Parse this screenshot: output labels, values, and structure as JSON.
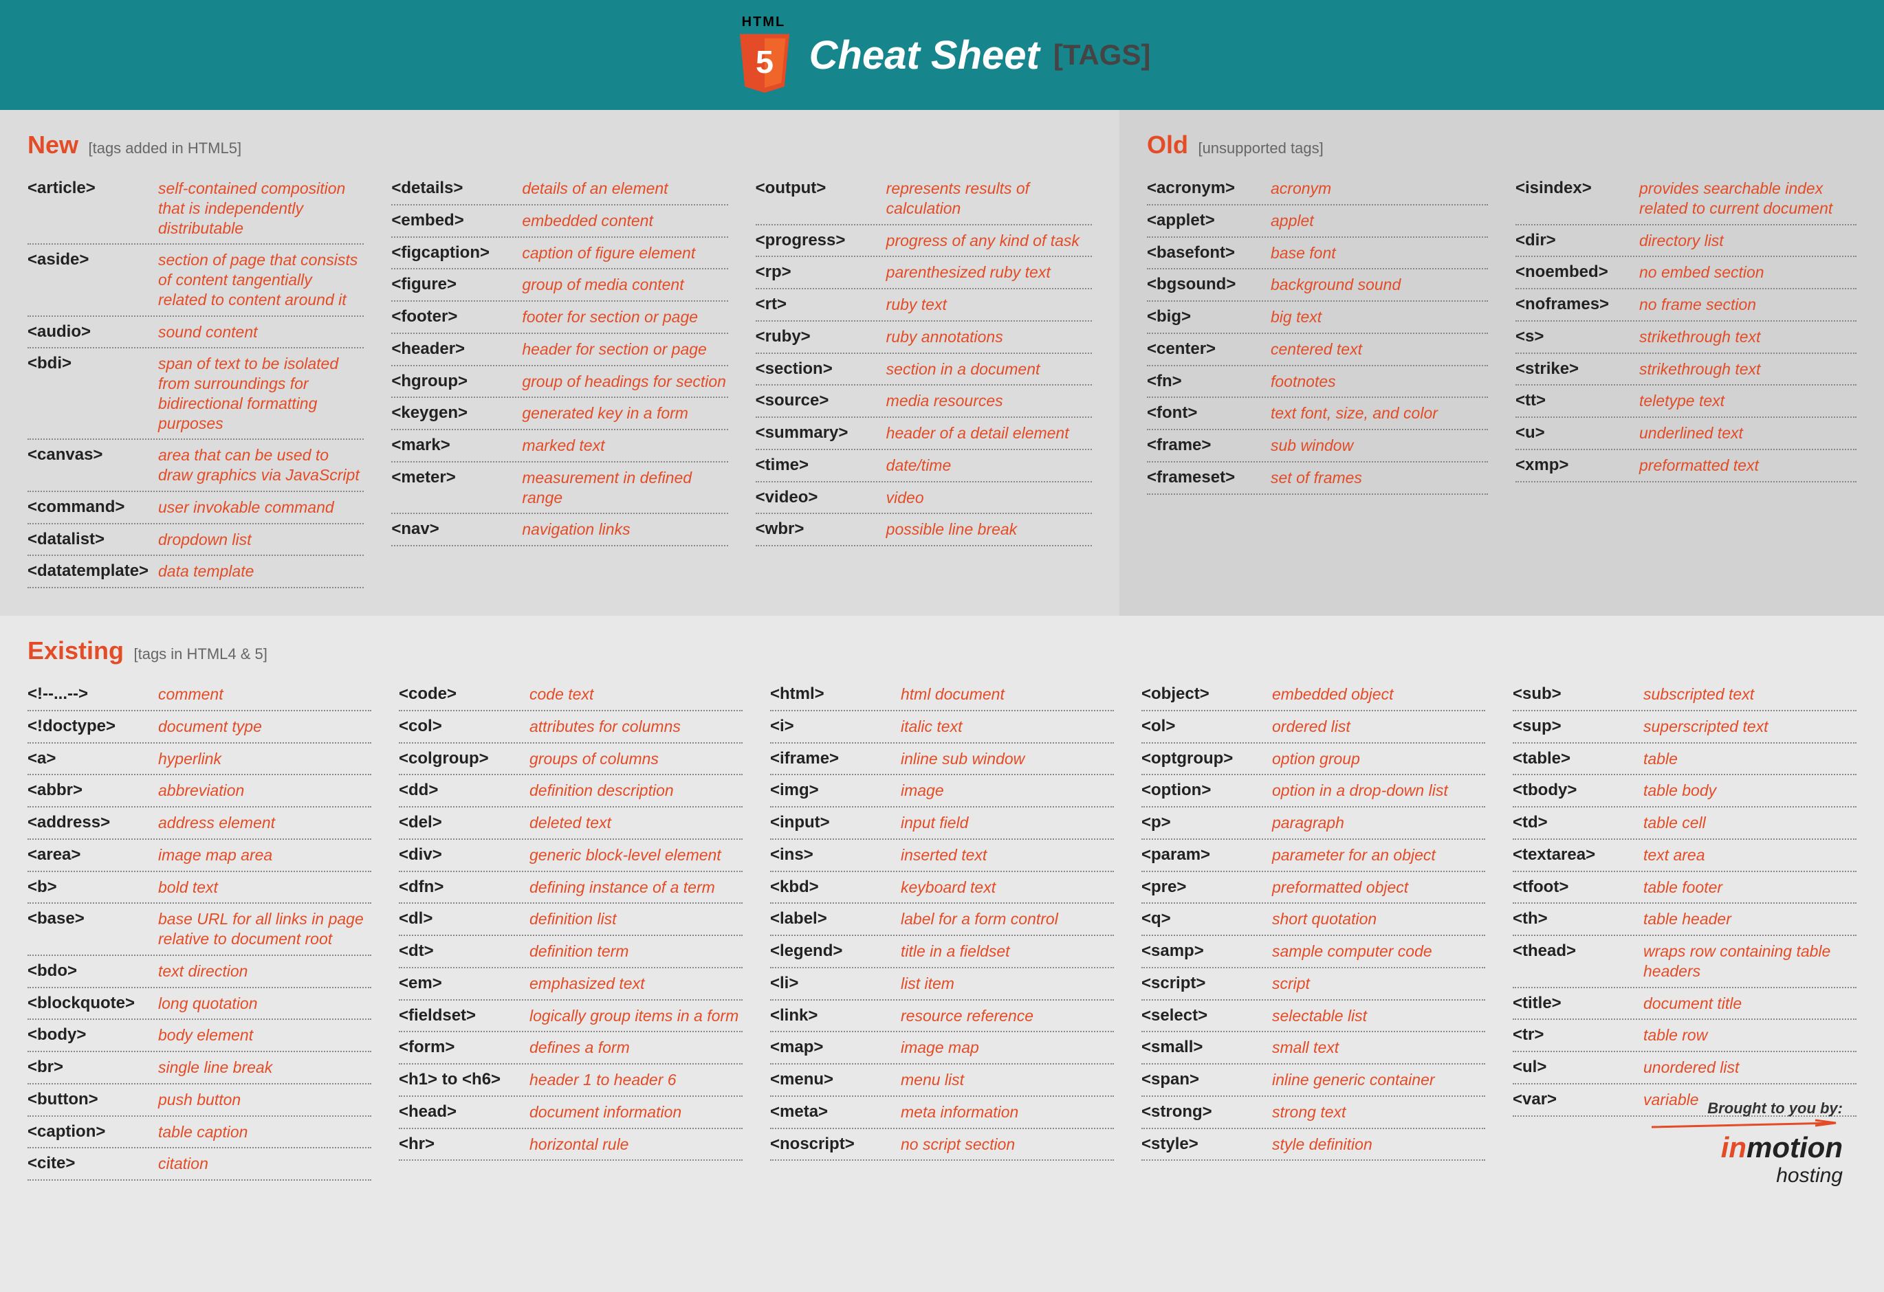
{
  "header": {
    "badge_label": "HTML",
    "title": "Cheat Sheet",
    "tags_label": "[TAGS]"
  },
  "new": {
    "title": "New",
    "subtitle": "[tags added in HTML5]",
    "cols": [
      [
        {
          "tag": "<article>",
          "desc": "self-contained composition that is independently distributable"
        },
        {
          "tag": "<aside>",
          "desc": "section of page that consists of content tangentially related to content around it"
        },
        {
          "tag": "<audio>",
          "desc": "sound content"
        },
        {
          "tag": "<bdi>",
          "desc": "span of text to be isolated from surroundings for bidirectional formatting purposes"
        },
        {
          "tag": "<canvas>",
          "desc": "area that can be used to draw graphics via JavaScript"
        },
        {
          "tag": "<command>",
          "desc": "user invokable command"
        },
        {
          "tag": "<datalist>",
          "desc": "dropdown list"
        },
        {
          "tag": "<datatemplate>",
          "desc": "data template"
        }
      ],
      [
        {
          "tag": "<details>",
          "desc": "details of an element"
        },
        {
          "tag": "<embed>",
          "desc": "embedded content"
        },
        {
          "tag": "<figcaption>",
          "desc": "caption of figure element"
        },
        {
          "tag": "<figure>",
          "desc": "group of media content"
        },
        {
          "tag": "<footer>",
          "desc": "footer for section or page"
        },
        {
          "tag": "<header>",
          "desc": "header for section or page"
        },
        {
          "tag": "<hgroup>",
          "desc": "group of headings for section"
        },
        {
          "tag": "<keygen>",
          "desc": "generated key in a form"
        },
        {
          "tag": "<mark>",
          "desc": "marked text"
        },
        {
          "tag": "<meter>",
          "desc": "measurement in defined range"
        },
        {
          "tag": "<nav>",
          "desc": "navigation links"
        }
      ],
      [
        {
          "tag": "<output>",
          "desc": "represents results of calculation"
        },
        {
          "tag": "<progress>",
          "desc": "progress of any kind of task"
        },
        {
          "tag": "<rp>",
          "desc": "parenthesized ruby text"
        },
        {
          "tag": "<rt>",
          "desc": "ruby text"
        },
        {
          "tag": "<ruby>",
          "desc": "ruby annotations"
        },
        {
          "tag": "<section>",
          "desc": "section in a document"
        },
        {
          "tag": "<source>",
          "desc": "media resources"
        },
        {
          "tag": "<summary>",
          "desc": "header of a detail element"
        },
        {
          "tag": "<time>",
          "desc": "date/time"
        },
        {
          "tag": "<video>",
          "desc": "video"
        },
        {
          "tag": "<wbr>",
          "desc": "possible line break"
        }
      ]
    ]
  },
  "old": {
    "title": "Old",
    "subtitle": "[unsupported tags]",
    "cols": [
      [
        {
          "tag": "<acronym>",
          "desc": "acronym"
        },
        {
          "tag": "<applet>",
          "desc": "applet"
        },
        {
          "tag": "<basefont>",
          "desc": "base font"
        },
        {
          "tag": "<bgsound>",
          "desc": "background sound"
        },
        {
          "tag": "<big>",
          "desc": "big text"
        },
        {
          "tag": "<center>",
          "desc": "centered text"
        },
        {
          "tag": "<fn>",
          "desc": "footnotes"
        },
        {
          "tag": "<font>",
          "desc": "text font, size, and color"
        },
        {
          "tag": "<frame>",
          "desc": "sub window"
        },
        {
          "tag": "<frameset>",
          "desc": "set of frames"
        }
      ],
      [
        {
          "tag": "<isindex>",
          "desc": "provides searchable index related to current document"
        },
        {
          "tag": "<dir>",
          "desc": "directory list"
        },
        {
          "tag": "<noembed>",
          "desc": "no embed section"
        },
        {
          "tag": "<noframes>",
          "desc": "no frame section"
        },
        {
          "tag": "<s>",
          "desc": "strikethrough text"
        },
        {
          "tag": "<strike>",
          "desc": "strikethrough text"
        },
        {
          "tag": "<tt>",
          "desc": "teletype text"
        },
        {
          "tag": "<u>",
          "desc": "underlined text"
        },
        {
          "tag": "<xmp>",
          "desc": "preformatted text"
        }
      ]
    ]
  },
  "existing": {
    "title": "Existing",
    "subtitle": "[tags in HTML4 & 5]",
    "cols": [
      [
        {
          "tag": "<!--...-->",
          "desc": "comment"
        },
        {
          "tag": "<!doctype>",
          "desc": "document type"
        },
        {
          "tag": "<a>",
          "desc": "hyperlink"
        },
        {
          "tag": "<abbr>",
          "desc": "abbreviation"
        },
        {
          "tag": "<address>",
          "desc": "address element"
        },
        {
          "tag": "<area>",
          "desc": "image map area"
        },
        {
          "tag": "<b>",
          "desc": "bold text"
        },
        {
          "tag": "<base>",
          "desc": "base URL for all links in page relative to document root"
        },
        {
          "tag": "<bdo>",
          "desc": "text direction"
        },
        {
          "tag": "<blockquote>",
          "desc": "long quotation"
        },
        {
          "tag": "<body>",
          "desc": "body element"
        },
        {
          "tag": "<br>",
          "desc": "single line break"
        },
        {
          "tag": "<button>",
          "desc": "push button"
        },
        {
          "tag": "<caption>",
          "desc": "table caption"
        },
        {
          "tag": "<cite>",
          "desc": "citation"
        }
      ],
      [
        {
          "tag": "<code>",
          "desc": "code text"
        },
        {
          "tag": "<col>",
          "desc": "attributes for columns"
        },
        {
          "tag": "<colgroup>",
          "desc": "groups of columns"
        },
        {
          "tag": "<dd>",
          "desc": "definition description"
        },
        {
          "tag": "<del>",
          "desc": "deleted text"
        },
        {
          "tag": "<div>",
          "desc": "generic block-level element"
        },
        {
          "tag": "<dfn>",
          "desc": "defining instance of a term"
        },
        {
          "tag": "<dl>",
          "desc": "definition list"
        },
        {
          "tag": "<dt>",
          "desc": "definition term"
        },
        {
          "tag": "<em>",
          "desc": "emphasized text"
        },
        {
          "tag": "<fieldset>",
          "desc": "logically group items in a form"
        },
        {
          "tag": "<form>",
          "desc": "defines a form"
        },
        {
          "tag": "<h1> to <h6>",
          "desc": "header 1 to header 6"
        },
        {
          "tag": "<head>",
          "desc": "document information"
        },
        {
          "tag": "<hr>",
          "desc": "horizontal rule"
        }
      ],
      [
        {
          "tag": "<html>",
          "desc": "html document"
        },
        {
          "tag": "<i>",
          "desc": "italic text"
        },
        {
          "tag": "<iframe>",
          "desc": "inline sub window"
        },
        {
          "tag": "<img>",
          "desc": "image"
        },
        {
          "tag": "<input>",
          "desc": "input field"
        },
        {
          "tag": "<ins>",
          "desc": "inserted text"
        },
        {
          "tag": "<kbd>",
          "desc": "keyboard text"
        },
        {
          "tag": "<label>",
          "desc": "label for a form control"
        },
        {
          "tag": "<legend>",
          "desc": "title in a fieldset"
        },
        {
          "tag": "<li>",
          "desc": "list item"
        },
        {
          "tag": "<link>",
          "desc": "resource reference"
        },
        {
          "tag": "<map>",
          "desc": "image map"
        },
        {
          "tag": "<menu>",
          "desc": "menu list"
        },
        {
          "tag": "<meta>",
          "desc": "meta information"
        },
        {
          "tag": "<noscript>",
          "desc": "no script section"
        }
      ],
      [
        {
          "tag": "<object>",
          "desc": "embedded object"
        },
        {
          "tag": "<ol>",
          "desc": "ordered list"
        },
        {
          "tag": "<optgroup>",
          "desc": "option group"
        },
        {
          "tag": "<option>",
          "desc": "option in a drop-down list"
        },
        {
          "tag": "<p>",
          "desc": "paragraph"
        },
        {
          "tag": "<param>",
          "desc": "parameter for an object"
        },
        {
          "tag": "<pre>",
          "desc": "preformatted object"
        },
        {
          "tag": "<q>",
          "desc": "short quotation"
        },
        {
          "tag": "<samp>",
          "desc": "sample computer code"
        },
        {
          "tag": "<script>",
          "desc": "script"
        },
        {
          "tag": "<select>",
          "desc": "selectable list"
        },
        {
          "tag": "<small>",
          "desc": "small text"
        },
        {
          "tag": "<span>",
          "desc": "inline generic container"
        },
        {
          "tag": "<strong>",
          "desc": "strong text"
        },
        {
          "tag": "<style>",
          "desc": "style definition"
        }
      ],
      [
        {
          "tag": "<sub>",
          "desc": "subscripted text"
        },
        {
          "tag": "<sup>",
          "desc": "superscripted text"
        },
        {
          "tag": "<table>",
          "desc": "table"
        },
        {
          "tag": "<tbody>",
          "desc": "table body"
        },
        {
          "tag": "<td>",
          "desc": "table cell"
        },
        {
          "tag": "<textarea>",
          "desc": "text area"
        },
        {
          "tag": "<tfoot>",
          "desc": "table footer"
        },
        {
          "tag": "<th>",
          "desc": "table header"
        },
        {
          "tag": "<thead>",
          "desc": "wraps row containing table headers"
        },
        {
          "tag": "<title>",
          "desc": "document title"
        },
        {
          "tag": "<tr>",
          "desc": "table row"
        },
        {
          "tag": "<ul>",
          "desc": "unordered list"
        },
        {
          "tag": "<var>",
          "desc": "variable"
        }
      ]
    ]
  },
  "footer": {
    "brought": "Brought to you by:",
    "brand_in": "in",
    "brand_motion": "motion",
    "brand_sub": "hosting"
  }
}
